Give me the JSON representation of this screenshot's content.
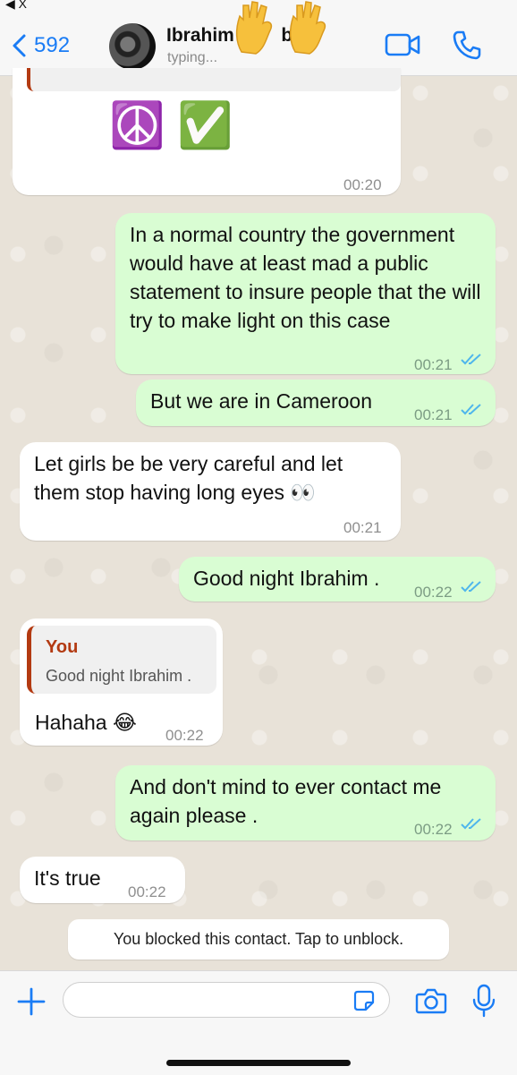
{
  "status_bar": {
    "back_label": "◀ X"
  },
  "header": {
    "back_count": "592",
    "contact_name": "Ibrahim",
    "contact_name_suffix": "bi",
    "status": "typing..."
  },
  "messages": [
    {
      "direction": "in",
      "text": "☮️  ✅",
      "time": "00:20"
    },
    {
      "direction": "out",
      "text": "In a normal country the government would have at least mad a public statement to insure people that the will try to make light on this case",
      "time": "00:21",
      "read": true
    },
    {
      "direction": "out",
      "text": "But we are in Cameroon",
      "time": "00:21",
      "read": true
    },
    {
      "direction": "in",
      "text": "Let girls be be very careful and let them stop having long eyes 👀",
      "time": "00:21"
    },
    {
      "direction": "out",
      "text": "Good night Ibrahim .",
      "time": "00:22",
      "read": true
    },
    {
      "direction": "in",
      "text": "Hahaha 😂",
      "time": "00:22",
      "reply_to": {
        "author": "You",
        "text": "Good night Ibrahim ."
      }
    },
    {
      "direction": "out",
      "text": "And don't mind to ever contact me again please .",
      "time": "00:22",
      "read": true
    },
    {
      "direction": "in",
      "text": "It's true",
      "time": "00:22"
    }
  ],
  "system_note": "You blocked this contact. Tap to unblock.",
  "composer": {
    "placeholder": ""
  },
  "colors": {
    "accent": "#1a7cf5",
    "outgoing_bubble": "#d9fdd3",
    "incoming_bubble": "#ffffff",
    "reply_accent": "#b33a12",
    "read_ticks": "#4fb6ec"
  },
  "icons": [
    "back-chevron-icon",
    "video-call-icon",
    "phone-icon",
    "plus-icon",
    "sticker-icon",
    "camera-icon",
    "microphone-icon",
    "waving-hands-icon"
  ]
}
